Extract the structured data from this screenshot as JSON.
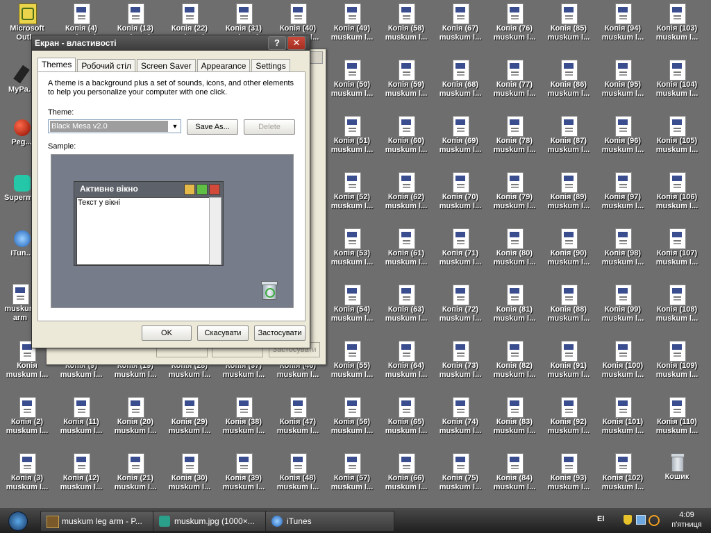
{
  "desktop": {
    "left_icons": [
      {
        "label": [
          "Microsoft",
          "Outl..."
        ]
      },
      {
        "label": [
          "MyPa...",
          ""
        ]
      },
      {
        "label": [
          "Peg...",
          ""
        ]
      },
      {
        "label": [
          "Superm...",
          ""
        ]
      },
      {
        "label": [
          "iTun...",
          ""
        ]
      },
      {
        "label": [
          "muskum",
          "arm"
        ]
      }
    ],
    "grid_icons": [
      [
        "Копія (4)",
        "muskum l..."
      ],
      [
        "Копія (13)",
        "muskum l..."
      ],
      [
        "Копія (22)",
        "muskum l..."
      ],
      [
        "Копія (31)",
        "muskum l..."
      ],
      [
        "Копія (40)",
        "muskum l..."
      ],
      [
        "Копія (49)",
        "muskum l..."
      ],
      [
        "Копія (58)",
        "muskum l..."
      ],
      [
        "Копія (67)",
        "muskum l..."
      ],
      [
        "Копія (76)",
        "muskum l..."
      ],
      [
        "Копія (85)",
        "muskum l..."
      ],
      [
        "Копія (94)",
        "muskum l..."
      ],
      [
        "Копія (103)",
        "muskum l..."
      ],
      [
        "Копія (50)",
        "muskum l..."
      ],
      [
        "Копія (59)",
        "muskum l..."
      ],
      [
        "Копія (68)",
        "muskum l..."
      ],
      [
        "Копія (77)",
        "muskum l..."
      ],
      [
        "Копія (86)",
        "muskum l..."
      ],
      [
        "Копія (95)",
        "muskum l..."
      ],
      [
        "Копія (104)",
        "muskum l..."
      ],
      [
        "Копія (51)",
        "muskum l..."
      ],
      [
        "Копія (60)",
        "muskum l..."
      ],
      [
        "Копія (69)",
        "muskum l..."
      ],
      [
        "Копія (78)",
        "muskum l..."
      ],
      [
        "Копія (87)",
        "muskum l..."
      ],
      [
        "Копія (96)",
        "muskum l..."
      ],
      [
        "Копія (105)",
        "muskum l..."
      ],
      [
        "Копія (52)",
        "muskum l..."
      ],
      [
        "Копія (62)",
        "muskum l..."
      ],
      [
        "Копія (70)",
        "muskum l..."
      ],
      [
        "Копія (79)",
        "muskum l..."
      ],
      [
        "Копія (89)",
        "muskum l..."
      ],
      [
        "Копія (97)",
        "muskum l..."
      ],
      [
        "Копія (106)",
        "muskum l..."
      ],
      [
        "Копія (53)",
        "muskum l..."
      ],
      [
        "Копія (61)",
        "muskum l..."
      ],
      [
        "Копія (71)",
        "muskum l..."
      ],
      [
        "Копія (80)",
        "muskum l..."
      ],
      [
        "Копія (90)",
        "muskum l..."
      ],
      [
        "Копія (98)",
        "muskum l..."
      ],
      [
        "Копія (107)",
        "muskum l..."
      ],
      [
        "Копія (54)",
        "muskum l..."
      ],
      [
        "Копія (63)",
        "muskum l..."
      ],
      [
        "Копія (72)",
        "muskum l..."
      ],
      [
        "Копія (81)",
        "muskum l..."
      ],
      [
        "Копія (88)",
        "muskum l..."
      ],
      [
        "Копія (99)",
        "muskum l..."
      ],
      [
        "Копія (108)",
        "muskum l..."
      ],
      [
        "Копія",
        "muskum l..."
      ],
      [
        "Копія (9)",
        "muskum l..."
      ],
      [
        "Копія (19)",
        "muskum l..."
      ],
      [
        "Копія (28)",
        "muskum l..."
      ],
      [
        "Копія (37)",
        "muskum l..."
      ],
      [
        "Копія (46)",
        "muskum l..."
      ],
      [
        "Копія (55)",
        "muskum l..."
      ],
      [
        "Копія (64)",
        "muskum l..."
      ],
      [
        "Копія (73)",
        "muskum l..."
      ],
      [
        "Копія (82)",
        "muskum l..."
      ],
      [
        "Копія (91)",
        "muskum l..."
      ],
      [
        "Копія (100)",
        "muskum l..."
      ],
      [
        "Копія (109)",
        "muskum l..."
      ],
      [
        "Копія (2)",
        "muskum l..."
      ],
      [
        "Копія (11)",
        "muskum l..."
      ],
      [
        "Копія (20)",
        "muskum l..."
      ],
      [
        "Копія (29)",
        "muskum l..."
      ],
      [
        "Копія (38)",
        "muskum l..."
      ],
      [
        "Копія (47)",
        "muskum l..."
      ],
      [
        "Копія (56)",
        "muskum l..."
      ],
      [
        "Копія (65)",
        "muskum l..."
      ],
      [
        "Копія (74)",
        "muskum l..."
      ],
      [
        "Копія (83)",
        "muskum l..."
      ],
      [
        "Копія (92)",
        "muskum l..."
      ],
      [
        "Копія (101)",
        "muskum l..."
      ],
      [
        "Копія (110)",
        "muskum l..."
      ],
      [
        "Копія (3)",
        "muskum l..."
      ],
      [
        "Копія (12)",
        "muskum l..."
      ],
      [
        "Копія (21)",
        "muskum l..."
      ],
      [
        "Копія (30)",
        "muskum l..."
      ],
      [
        "Копія (39)",
        "muskum l..."
      ],
      [
        "Копія (48)",
        "muskum l..."
      ],
      [
        "Копія (57)",
        "muskum l..."
      ],
      [
        "Копія (66)",
        "muskum l..."
      ],
      [
        "Копія (75)",
        "muskum l..."
      ],
      [
        "Копія (84)",
        "muskum l..."
      ],
      [
        "Копія (93)",
        "muskum l..."
      ],
      [
        "Копія (102)",
        "muskum l..."
      ]
    ],
    "recycle_bin_label": "Кошик"
  },
  "back_window": {
    "buttons": [
      "",
      "",
      "Застосувати"
    ]
  },
  "dialog": {
    "title": "Екран - властивості",
    "help_label": "?",
    "close_label": "✕",
    "tabs": [
      "Themes",
      "Робочий стіл",
      "Screen Saver",
      "Appearance",
      "Settings"
    ],
    "active_tab": "Themes",
    "description": "A theme is a background plus a set of sounds, icons, and other elements to help you personalize your computer with one click.",
    "theme_label": "Theme:",
    "theme_value": "Black Mesa v2.0",
    "save_as": "Save As...",
    "delete": "Delete",
    "sample_label": "Sample:",
    "sample_window_title": "Активне вікно",
    "sample_window_text": "Текст у вікні",
    "ok": "OK",
    "cancel": "Скасувати",
    "apply": "Застосувати"
  },
  "taskbar": {
    "tasks": [
      "muskum leg arm - P...",
      "muskum.jpg (1000×...",
      "iTunes"
    ],
    "language": "El",
    "clock_time": "4:09",
    "clock_day": "п'ятниця"
  },
  "colors": {
    "desktop_bg": "#6e6e6e",
    "taskbar": "#2a2a2a",
    "dialog_bg": "#ece9d8",
    "sample_bg": "#767c8a"
  }
}
